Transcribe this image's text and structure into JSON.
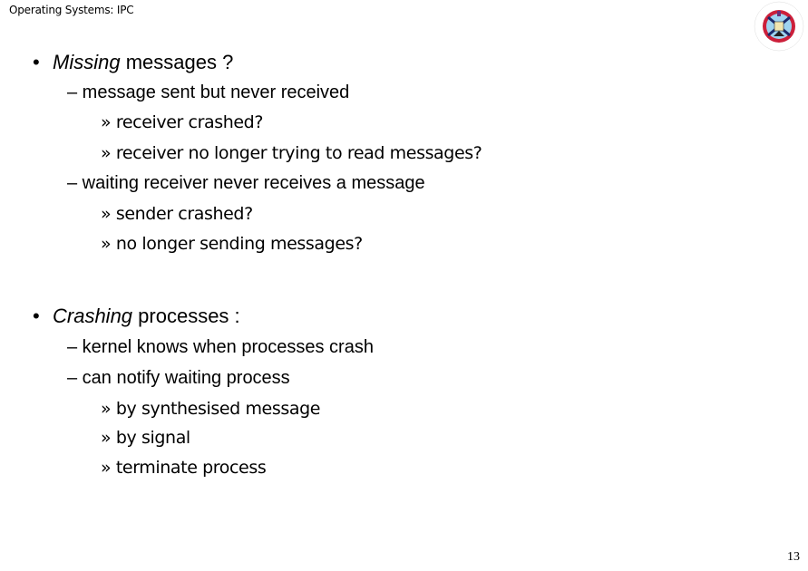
{
  "header": {
    "title": "Operating Systems: IPC"
  },
  "logo": {
    "name": "university-of-edinburgh-crest",
    "colors": {
      "ring": "#cc1f3a",
      "saltire": "#9fd3f0",
      "dark": "#1b2a6b"
    }
  },
  "sections": [
    {
      "emphasis": "Missing",
      "rest": " messages ?",
      "items": [
        {
          "text": "– message sent but never received",
          "subitems": [
            "» receiver crashed?",
            "» receiver no longer trying to read messages?"
          ]
        },
        {
          "text": "– waiting receiver never receives a message",
          "subitems": [
            "» sender crashed?",
            "» no longer sending messages?"
          ]
        }
      ]
    },
    {
      "emphasis": "Crashing",
      "rest": " processes :",
      "items": [
        {
          "text": "– kernel knows when processes crash",
          "subitems": []
        },
        {
          "text": "– can notify waiting process",
          "subitems": [
            "» by synthesised message",
            "» by signal",
            "» terminate process"
          ]
        }
      ]
    }
  ],
  "footer": {
    "page_number": "13"
  }
}
